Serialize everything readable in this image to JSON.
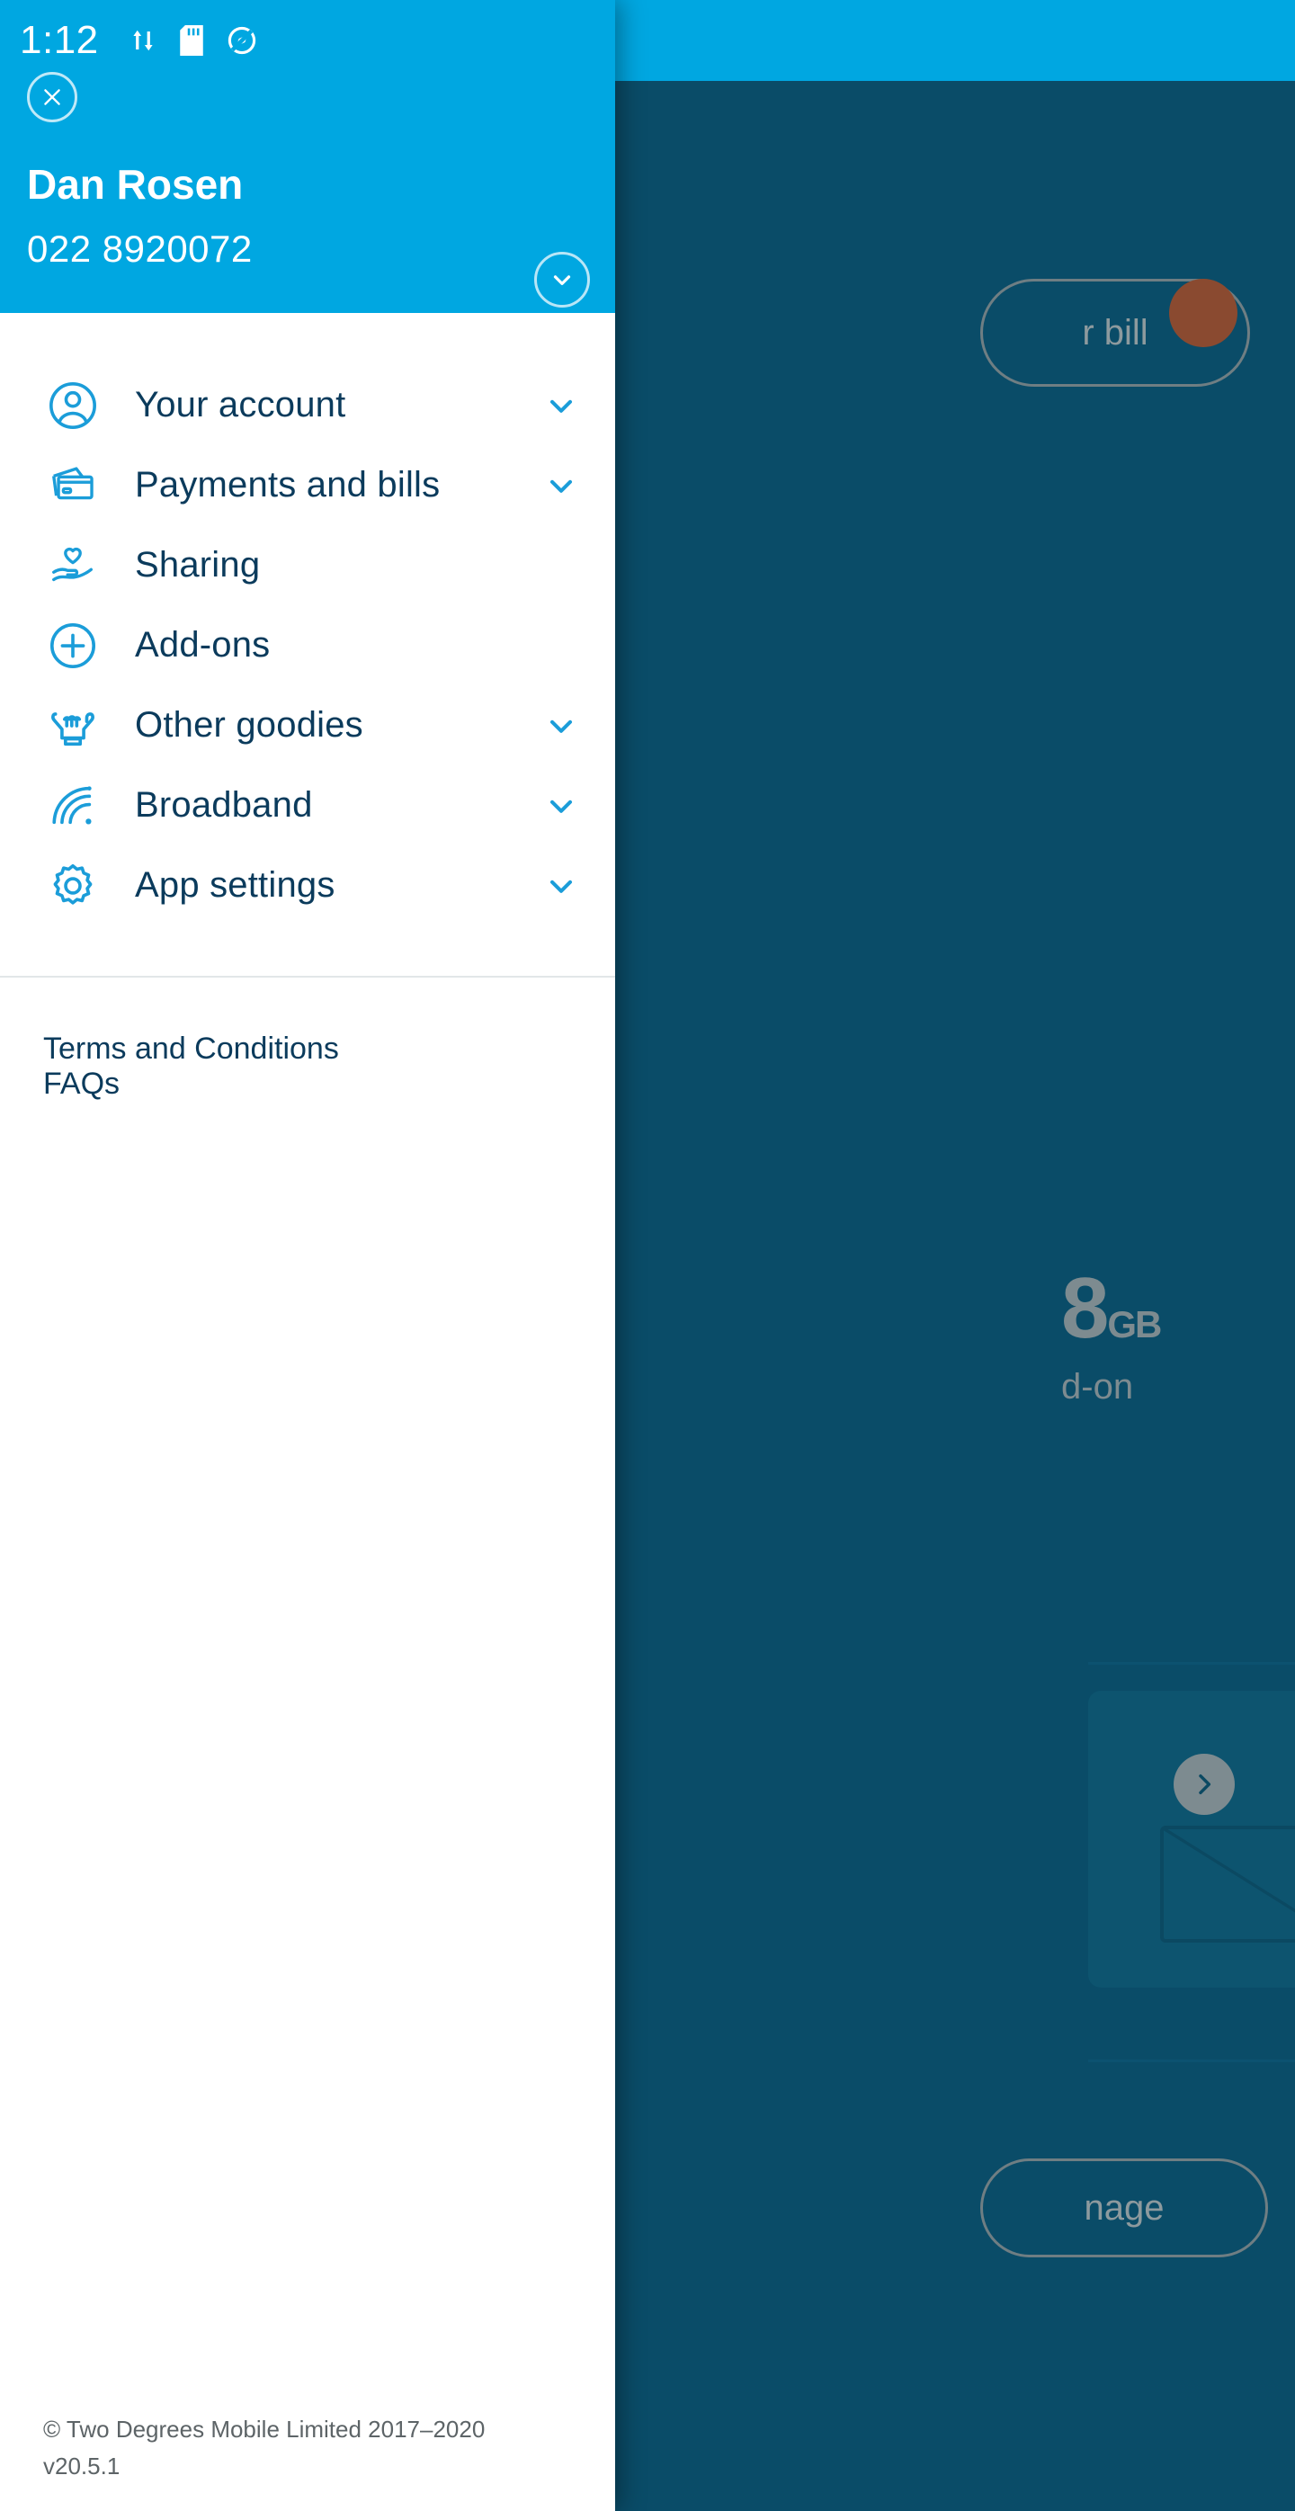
{
  "status_bar": {
    "time": "1:12",
    "left_icons": [
      "data-transfer-icon",
      "sd-card-icon",
      "location-off-icon"
    ],
    "right_icons": [
      "wifi-icon",
      "cellular-signal-icon",
      "battery-full-icon"
    ]
  },
  "drawer": {
    "close_label": "Close",
    "user": {
      "name": "Dan Rosen",
      "phone": "022 8920072"
    },
    "account_switch_icon": "chevron-down-icon",
    "menu": [
      {
        "label": "Your account",
        "icon": "person-circle-icon",
        "expandable": true
      },
      {
        "label": "Payments and bills",
        "icon": "credit-cards-icon",
        "expandable": true
      },
      {
        "label": "Sharing",
        "icon": "hand-heart-icon",
        "expandable": false
      },
      {
        "label": "Add-ons",
        "icon": "plus-circle-icon",
        "expandable": false
      },
      {
        "label": "Other goodies",
        "icon": "shaka-hand-icon",
        "expandable": true
      },
      {
        "label": "Broadband",
        "icon": "signal-arcs-icon",
        "expandable": true
      },
      {
        "label": "App settings",
        "icon": "gear-icon",
        "expandable": true
      }
    ],
    "links": [
      {
        "label": "Terms and Conditions"
      },
      {
        "label": "FAQs"
      }
    ],
    "copyright": "© Two Degrees Mobile Limited 2017–2020",
    "version": "v20.5.1"
  },
  "background": {
    "bill_button": "r bill",
    "manage_button": "nage",
    "data_amount": "8",
    "data_unit": "GB",
    "data_sub": "d-on",
    "card_arrow_icon": "chevron-right-icon",
    "envelope_icon": "envelope-icon"
  },
  "colors": {
    "brand_blue": "#00a7e1",
    "icon_blue": "#1b9dd9",
    "text_navy": "#0b3b5c",
    "backdrop": "#0a4c68",
    "badge_orange": "#8a4a30"
  }
}
